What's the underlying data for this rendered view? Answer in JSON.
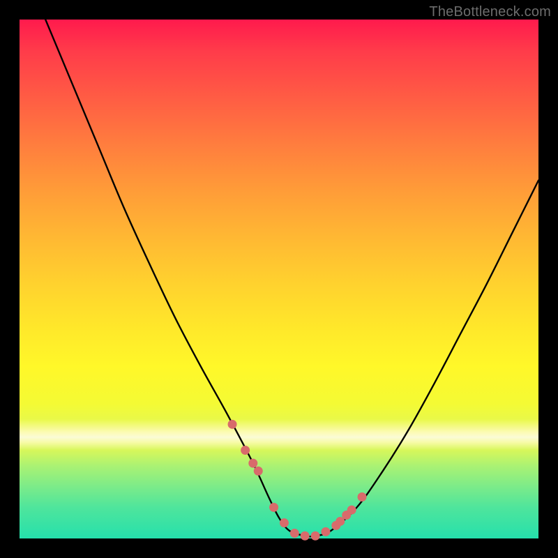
{
  "watermark": "TheBottleneck.com",
  "colors": {
    "background": "#000000",
    "curve_stroke": "#000000",
    "marker_fill": "#d86b6b",
    "gradient_top": "#ff1a4d",
    "gradient_mid": "#ffe92a",
    "gradient_band": "#fbfbd5",
    "gradient_bottom": "#25e0ac"
  },
  "chart_data": {
    "type": "line",
    "title": "",
    "xlabel": "",
    "ylabel": "",
    "xlim": [
      0,
      100
    ],
    "ylim": [
      0,
      100
    ],
    "series": [
      {
        "name": "bottleneck-curve",
        "x": [
          5,
          10,
          15,
          20,
          25,
          30,
          35,
          40,
          45,
          48,
          50,
          52,
          55,
          57,
          60,
          65,
          70,
          75,
          80,
          85,
          90,
          95,
          100
        ],
        "y": [
          100,
          88,
          76,
          64,
          53,
          42.5,
          33,
          24,
          14.5,
          8,
          4,
          1.5,
          0.5,
          0.5,
          1.5,
          6,
          13,
          21,
          30,
          39.5,
          49,
          59,
          69
        ]
      }
    ],
    "markers": {
      "name": "highlight-points",
      "x": [
        41,
        43.5,
        45,
        46,
        49,
        51,
        53,
        55,
        57,
        59,
        61,
        61.8,
        63,
        64,
        66
      ],
      "y": [
        22,
        17,
        14.5,
        13,
        6,
        3,
        1,
        0.5,
        0.5,
        1.3,
        2.5,
        3.3,
        4.5,
        5.5,
        8
      ]
    },
    "grid": false,
    "legend": false
  }
}
